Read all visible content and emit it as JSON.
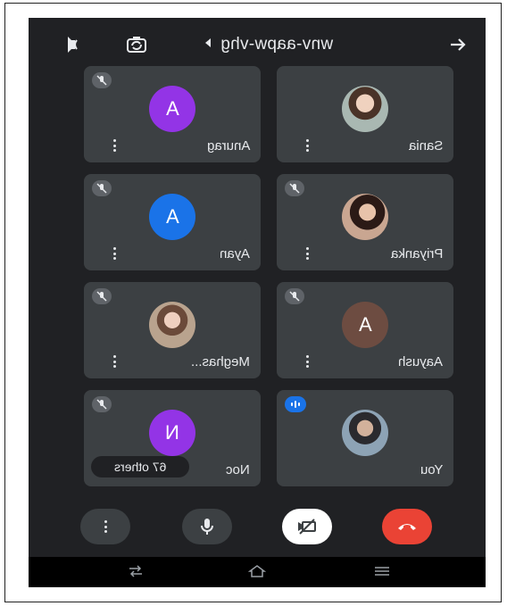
{
  "meeting": {
    "code": "wnv-aapw-vhg"
  },
  "colors": {
    "background": "#202124",
    "tile": "#3c4043",
    "end_call": "#ea4335",
    "speaking": "#1a73e8"
  },
  "participants": [
    {
      "name": "Sania",
      "avatar": "photo",
      "mic": "muted"
    },
    {
      "name": "Anurag",
      "avatar": "letter",
      "initial": "A",
      "avatar_color": "#9334e6",
      "mic": "muted"
    },
    {
      "name": "Priyanka",
      "avatar": "photo",
      "mic": "muted"
    },
    {
      "name": "Ayan",
      "avatar": "letter",
      "initial": "A",
      "avatar_color": "#1a73e8",
      "mic": "muted"
    },
    {
      "name": "Aayush",
      "avatar": "letter",
      "initial": "A",
      "avatar_color": "#6d4c41",
      "mic": "muted"
    },
    {
      "name": "Meghas...",
      "avatar": "photo",
      "mic": "muted"
    },
    {
      "name": "You",
      "avatar": "photo",
      "mic": "speaking"
    },
    {
      "name": "Noc",
      "avatar": "letter",
      "initial": "N",
      "avatar_color": "#9334e6",
      "mic": "muted",
      "others_label": "67 others"
    }
  ],
  "icons": {
    "top": [
      "audio-output-icon",
      "switch-camera-icon",
      "caret-icon",
      "forward-arrow-icon"
    ],
    "controls": [
      "more-options-icon",
      "microphone-icon",
      "camera-off-icon",
      "end-call-icon"
    ],
    "nav": [
      "recents-icon",
      "home-icon",
      "back-icon"
    ]
  }
}
